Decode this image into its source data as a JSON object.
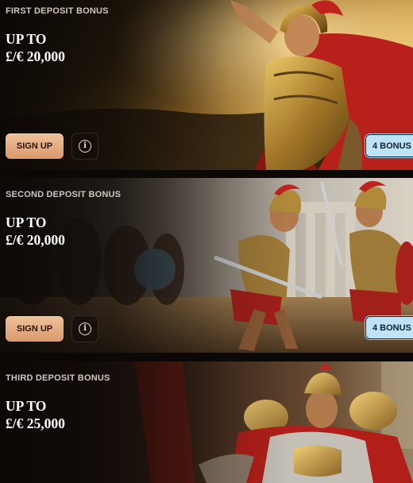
{
  "cards": [
    {
      "title": "FIRST DEPOSIT BONUS",
      "amount_line1": "UP TO",
      "amount_line2": "£/€ 20,000",
      "signup_label": "SIGN UP",
      "info_icon": "info-icon",
      "bonus_count_label": "4 BONUS",
      "art": "gladiator-raising-sword"
    },
    {
      "title": "SECOND DEPOSIT BONUS",
      "amount_line1": "UP TO",
      "amount_line2": "£/€ 20,000",
      "signup_label": "SIGN UP",
      "info_icon": "info-icon",
      "bonus_count_label": "4 BONUS",
      "art": "two-gladiators-fighting"
    },
    {
      "title": "THIRD DEPOSIT BONUS",
      "amount_line1": "UP TO",
      "amount_line2": "£/€ 25,000",
      "art": "emperor-on-lion-throne"
    }
  ],
  "colors": {
    "signup_button": "#e3ad84",
    "bonus_tag": "#bfe3f6",
    "page_background": "#0b0806"
  }
}
